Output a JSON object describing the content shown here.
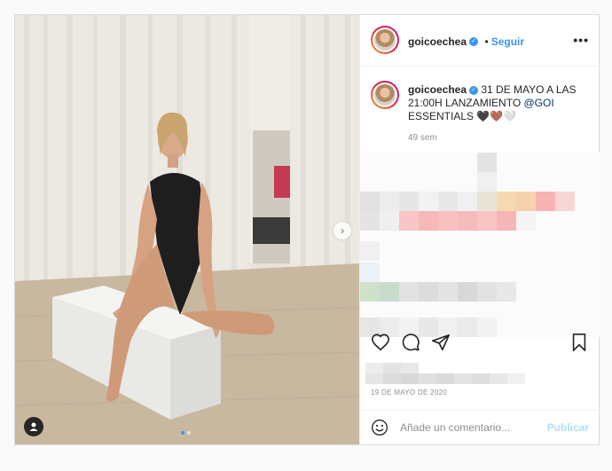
{
  "post": {
    "username": "goicoechea",
    "follow_label": "Seguir",
    "more_label": "•••",
    "next_arrow": "›",
    "caption": {
      "username": "goicoechea",
      "text": "31 DE MAYO A LAS 21:00H LANZAMIENTO",
      "mention": "@GOI",
      "text2": "ESSENTIALS 🖤🤎🤍"
    },
    "time_ago": "49 sem",
    "date": "19 DE MAYO DE 2020",
    "comment_placeholder": "Añade un comentario...",
    "publish_label": "Publicar",
    "carousel": {
      "count": 2,
      "active": 0
    },
    "colors": {
      "accent": "#3897f0",
      "link": "#00376b",
      "muted": "#8e8e8e"
    },
    "icons": [
      "heart-icon",
      "comment-icon",
      "share-icon",
      "bookmark-icon",
      "emoji-icon",
      "user-tag-icon",
      "verified-icon",
      "more-icon",
      "chevron-right-icon"
    ]
  }
}
